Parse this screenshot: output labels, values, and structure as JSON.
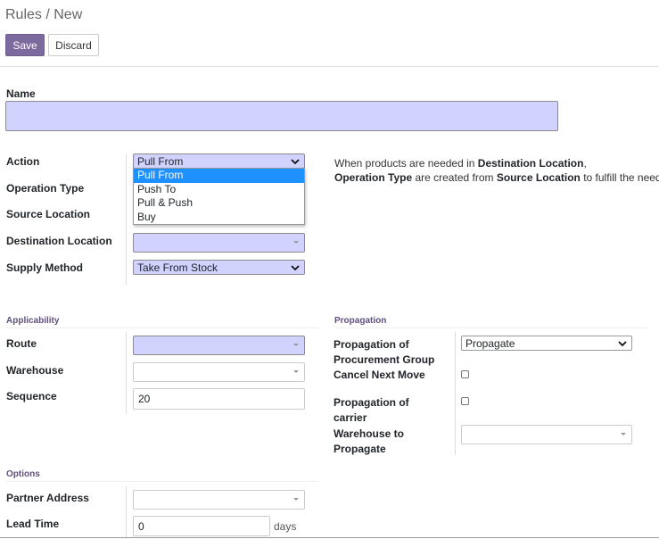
{
  "breadcrumb": {
    "parent": "Rules",
    "separator": " / ",
    "current": "New"
  },
  "toolbar": {
    "save_label": "Save",
    "discard_label": "Discard"
  },
  "form": {
    "name_label": "Name",
    "name_value": "",
    "action_label": "Action",
    "action_value": "Pull From",
    "action_options": [
      "Pull From",
      "Push To",
      "Pull & Push",
      "Buy"
    ],
    "operation_type_label": "Operation Type",
    "source_location_label": "Source Location",
    "destination_location_label": "Destination Location",
    "supply_method_label": "Supply Method",
    "supply_method_value": "Take From Stock",
    "help": {
      "p1": "When products are needed in ",
      "b1": "Destination Location",
      "p2": ",",
      "b2": "Operation Type",
      "p3": " are created from ",
      "b3": "Source Location",
      "p4": " to fulfill the need."
    }
  },
  "applicability": {
    "title": "Applicability",
    "route_label": "Route",
    "warehouse_label": "Warehouse",
    "sequence_label": "Sequence",
    "sequence_value": "20"
  },
  "propagation": {
    "title": "Propagation",
    "group_label_1": "Propagation of",
    "group_label_2": "Procurement Group",
    "group_value": "Propagate",
    "cancel_next_label": "Cancel Next Move",
    "carrier_label_1": "Propagation of",
    "carrier_label_2": "carrier",
    "wh_propagate_label_1": "Warehouse to",
    "wh_propagate_label_2": "Propagate"
  },
  "options": {
    "title": "Options",
    "partner_address_label": "Partner Address",
    "lead_time_label": "Lead Time",
    "lead_time_value": "0",
    "lead_time_unit": "days"
  },
  "colors": {
    "primary": "#7c6a9e",
    "required_bg": "#d2d2ff",
    "highlight": "#1e90ff"
  }
}
